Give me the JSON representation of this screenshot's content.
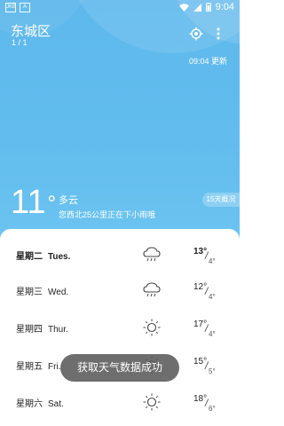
{
  "status_bar": {
    "left_icons": [
      "JKB",
      "A"
    ],
    "time": "9:04",
    "right_icons": [
      "wifi-icon",
      "signal-icon",
      "battery-icon"
    ]
  },
  "location": {
    "city": "东城区",
    "page_indicator": "1 / 1"
  },
  "header": {
    "update_text": "09:04 更新",
    "icons": [
      "gps-icon",
      "menu-icon"
    ]
  },
  "current": {
    "temp": "11",
    "degree_symbol": "°",
    "condition": "多云",
    "precip_message": "您西北25公里正在下小雨哦",
    "forecast_button": "15天概况"
  },
  "forecast": [
    {
      "day_cn": "星期二",
      "day_en": "Tues.",
      "icon": "cloud-rain-icon",
      "high": "13°",
      "low": "4°"
    },
    {
      "day_cn": "星期三",
      "day_en": "Wed.",
      "icon": "cloud-rain-icon",
      "high": "12°",
      "low": "4°"
    },
    {
      "day_cn": "星期四",
      "day_en": "Thur.",
      "icon": "sun-icon",
      "high": "17°",
      "low": "4°"
    },
    {
      "day_cn": "星期五",
      "day_en": "Fri.",
      "icon": "sun-icon",
      "high": "15°",
      "low": "5°"
    },
    {
      "day_cn": "星期六",
      "day_en": "Sat.",
      "icon": "sun-icon",
      "high": "18°",
      "low": "6°"
    }
  ],
  "toast": "获取天气数据成功",
  "colors": {
    "sky": "#62bdee",
    "panel": "#ffffff",
    "toast_bg": "#5a5a5a"
  }
}
